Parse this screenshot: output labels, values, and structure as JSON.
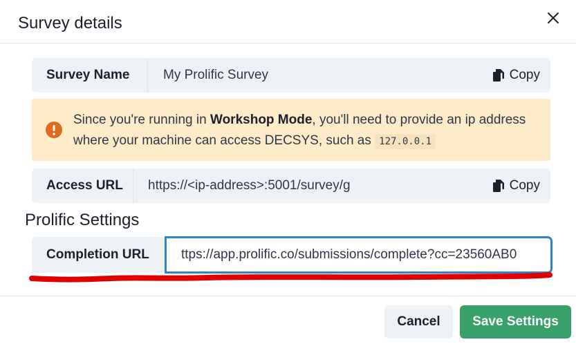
{
  "dialog": {
    "title": "Survey details"
  },
  "survey_name": {
    "label": "Survey Name",
    "value": "My Prolific Survey",
    "copy_label": "Copy"
  },
  "alert": {
    "text_before": "Since you're running in ",
    "emphasis": "Workshop Mode",
    "text_after": ", you'll need to provide an ip address where your machine can access DECSYS, such as ",
    "code": "127.0.0.1"
  },
  "access_url": {
    "label": "Access URL",
    "value": "https://<ip-address>:5001/survey/g",
    "copy_label": "Copy"
  },
  "prolific": {
    "section_title": "Prolific Settings",
    "completion_label": "Completion URL",
    "completion_value": "ttps://app.prolific.co/submissions/complete?cc=23560AB0"
  },
  "footer": {
    "cancel_label": "Cancel",
    "save_label": "Save Settings"
  },
  "colors": {
    "alert_bg": "#feebc8",
    "alert_icon": "#dd6b20",
    "save_button": "#38a169",
    "focus_border": "#3182ce",
    "annotation_mark": "#e00000"
  }
}
